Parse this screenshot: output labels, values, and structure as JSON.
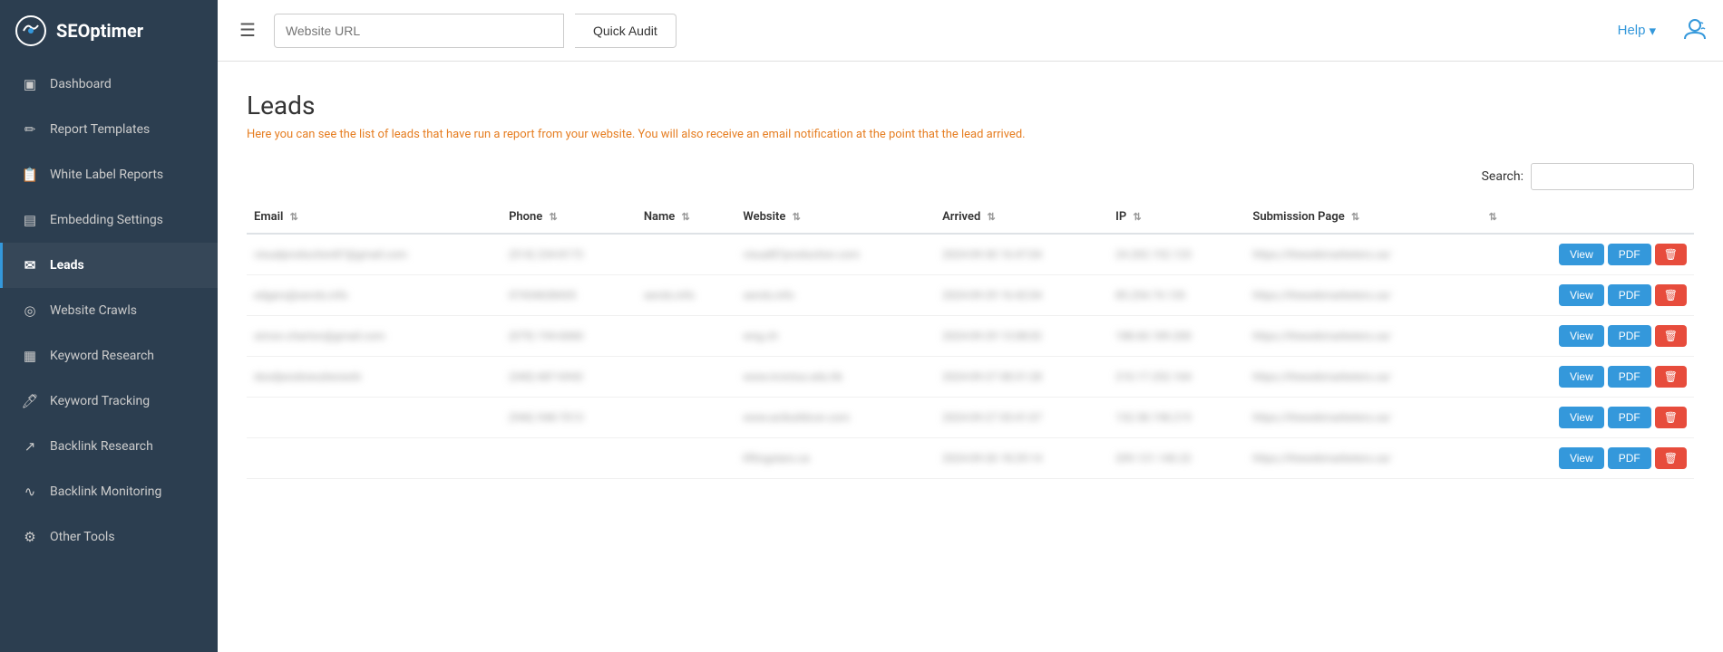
{
  "header": {
    "logo_text": "SEOptimer",
    "url_placeholder": "Website URL",
    "quick_audit_label": "Quick Audit",
    "help_label": "Help",
    "help_chevron": "▾"
  },
  "sidebar": {
    "items": [
      {
        "id": "dashboard",
        "label": "Dashboard",
        "icon": "⊞",
        "active": false
      },
      {
        "id": "report-templates",
        "label": "Report Templates",
        "icon": "✎",
        "active": false
      },
      {
        "id": "white-label-reports",
        "label": "White Label Reports",
        "icon": "📄",
        "active": false
      },
      {
        "id": "embedding-settings",
        "label": "Embedding Settings",
        "icon": "⊡",
        "active": false
      },
      {
        "id": "leads",
        "label": "Leads",
        "icon": "✉",
        "active": true
      },
      {
        "id": "website-crawls",
        "label": "Website Crawls",
        "icon": "🔍",
        "active": false
      },
      {
        "id": "keyword-research",
        "label": "Keyword Research",
        "icon": "📊",
        "active": false
      },
      {
        "id": "keyword-tracking",
        "label": "Keyword Tracking",
        "icon": "📈",
        "active": false
      },
      {
        "id": "backlink-research",
        "label": "Backlink Research",
        "icon": "↗",
        "active": false
      },
      {
        "id": "backlink-monitoring",
        "label": "Backlink Monitoring",
        "icon": "📉",
        "active": false
      },
      {
        "id": "other-tools",
        "label": "Other Tools",
        "icon": "🔧",
        "active": false
      }
    ]
  },
  "main": {
    "page_title": "Leads",
    "page_subtitle": "Here you can see the list of leads that have run a report from your website. You will also receive an email notification at the point that the lead arrived.",
    "search_label": "Search:",
    "search_placeholder": "",
    "table": {
      "columns": [
        {
          "id": "email",
          "label": "Email"
        },
        {
          "id": "phone",
          "label": "Phone"
        },
        {
          "id": "name",
          "label": "Name"
        },
        {
          "id": "website",
          "label": "Website"
        },
        {
          "id": "arrived",
          "label": "Arrived"
        },
        {
          "id": "ip",
          "label": "IP"
        },
        {
          "id": "submission_page",
          "label": "Submission Page"
        }
      ],
      "rows": [
        {
          "email": "visualproduction87@gmail.com",
          "phone": "(514) 234-8173",
          "name": "",
          "website": "visual87production.com",
          "arrived": "2024-09-30 16:47:04",
          "ip": "24.202.152.123",
          "submission_page": "https://thewebmarketers.ca/"
        },
        {
          "email": "edgars@serols.info",
          "phone": "07434638435",
          "name": "serols.info",
          "website": "serols.info",
          "arrived": "2024-09-29 16:42:04",
          "ip": "85.254.74.135",
          "submission_page": "https://thewebmarketers.ca/"
        },
        {
          "email": "simon.charton@gmail.com",
          "phone": "(079) 194-6060",
          "name": "",
          "website": "wng.ch",
          "arrived": "2024-09-29 13:08:02",
          "ip": "188.60.189.200",
          "submission_page": "https://thewebmarketers.ca/"
        },
        {
          "email": "dsodjwodowudwowdv",
          "phone": "(340) 687-6942",
          "name": "",
          "website": "www.invictus.edu.hk",
          "arrived": "2024-09-27 08:31:28",
          "ip": "210.17.252.164",
          "submission_page": "https://thewebmarketers.ca/"
        },
        {
          "email": "",
          "phone": "(946) 948-7013",
          "name": "",
          "website": "www.acibuildcon.com",
          "arrived": "2024-09-27 05:41:07",
          "ip": "152.58.198.219",
          "submission_page": "https://thewebmarketers.ca/"
        },
        {
          "email": "",
          "phone": "",
          "name": "",
          "website": "liftingstars.ca",
          "arrived": "2024-09-26 18:29:14",
          "ip": "209.121.140.22",
          "submission_page": "https://thewebmarketers.ca/"
        }
      ],
      "btn_view": "View",
      "btn_pdf": "PDF"
    }
  }
}
